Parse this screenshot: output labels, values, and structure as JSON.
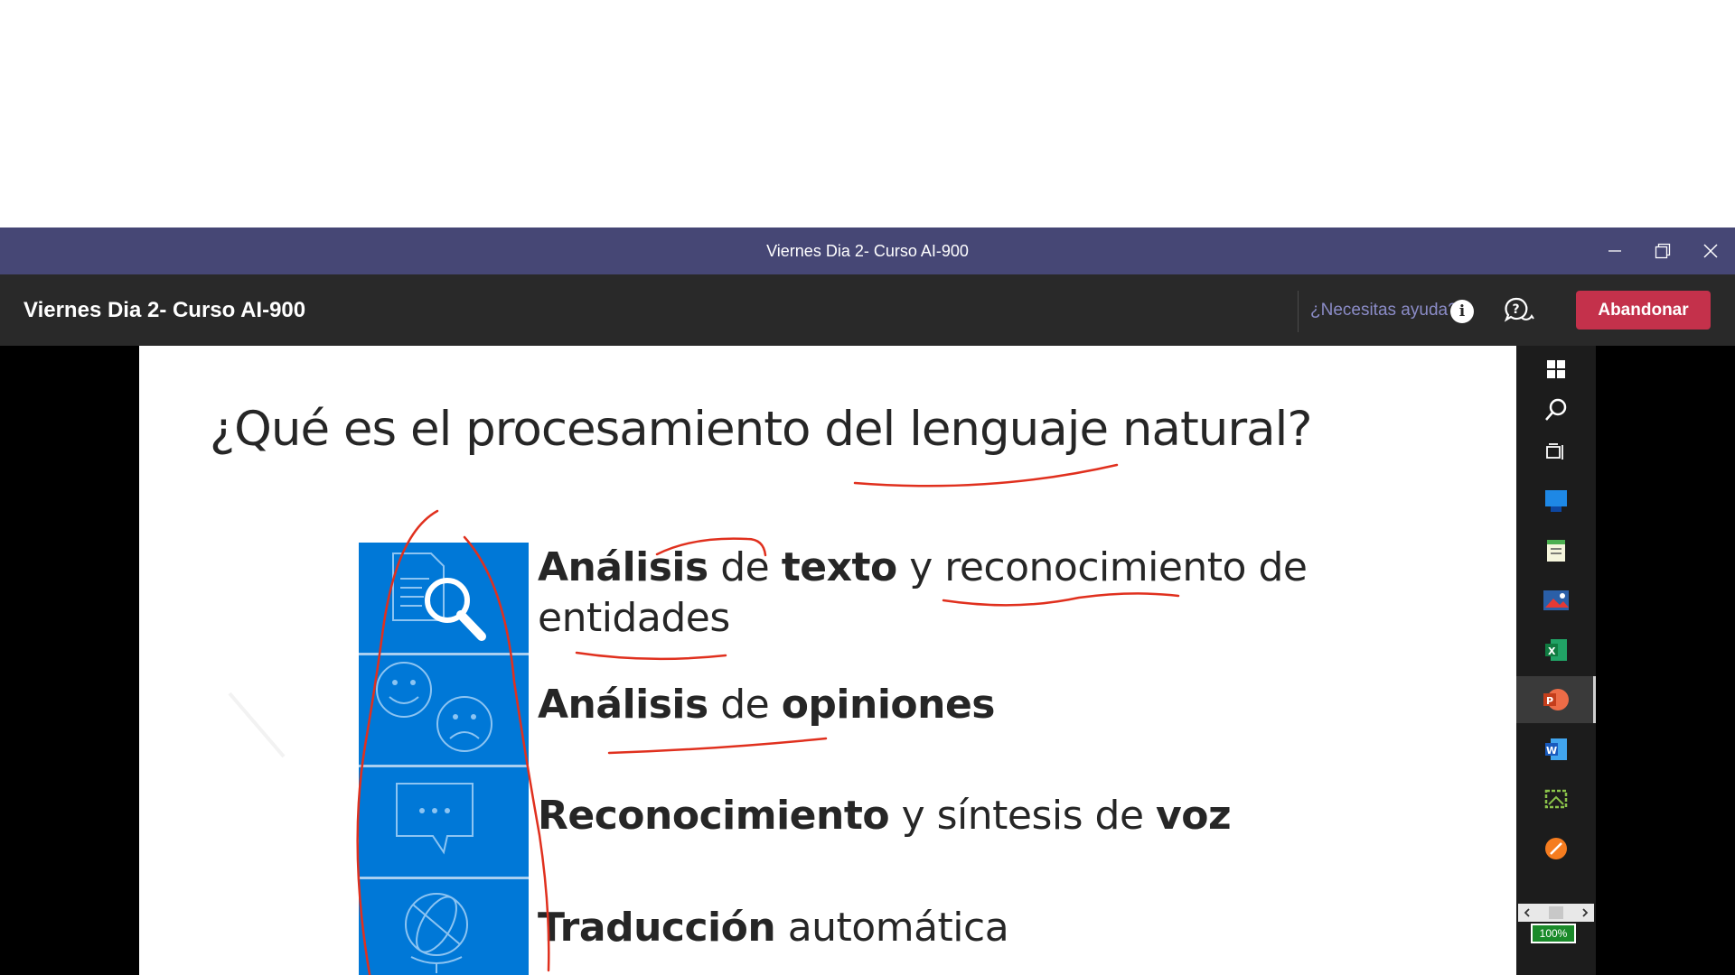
{
  "window": {
    "title": "Viernes Dia 2- Curso AI-900"
  },
  "header": {
    "meeting_title": "Viernes Dia 2- Curso AI-900",
    "help_link": "¿Necesitas ayuda?",
    "leave_label": "Abandonar"
  },
  "slide": {
    "title": "¿Qué es el procesamiento del lenguaje natural?",
    "features": [
      {
        "b1": "Análisis",
        "t1": " de ",
        "b2": "texto",
        "t2": " y reconocimiento de",
        "line2": "entidades"
      },
      {
        "b1": "Análisis",
        "t1": " de ",
        "b2": "opiniones"
      },
      {
        "b1": "Reconocimiento",
        "t1": " y síntesis de ",
        "b2": "voz"
      },
      {
        "b1": "Traducción",
        "t1": " automática"
      }
    ]
  },
  "taskbar": {
    "items": [
      "windows-start",
      "search",
      "task-view",
      "app-blue",
      "notepad",
      "photos",
      "excel",
      "powerpoint",
      "word",
      "snipping",
      "app-orange"
    ],
    "active": "powerpoint",
    "battery": "100%"
  },
  "colors": {
    "titlebar": "#464775",
    "header": "#292929",
    "leave": "#c4314b",
    "slide_icons": "#0078d7",
    "ink": "#e0301e"
  }
}
